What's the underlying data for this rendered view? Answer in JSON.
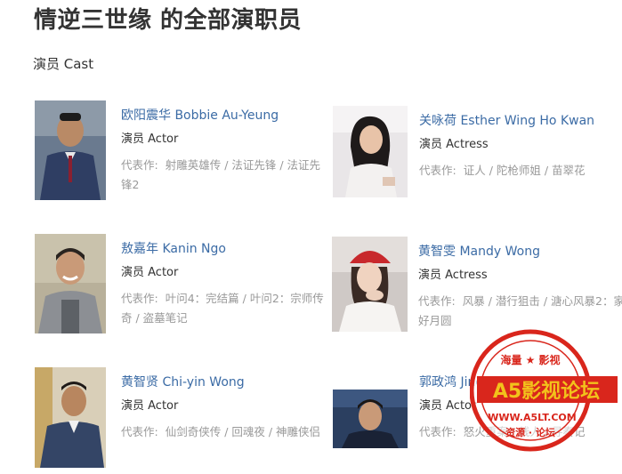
{
  "header": {
    "title": "情逆三世缘 的全部演职员",
    "section": "演员 Cast"
  },
  "cast": [
    {
      "name": "欧阳震华 Bobbie Au-Yeung",
      "role": "演员 Actor",
      "works_label": "代表作:",
      "works": "射雕英雄传 / 法证先锋 / 法证先锋2"
    },
    {
      "name": "关咏荷 Esther Wing Ho Kwan",
      "role": "演员 Actress",
      "works_label": "代表作:",
      "works": "证人 / 陀枪师姐 / 苗翠花"
    },
    {
      "name": "敖嘉年 Kanin Ngo",
      "role": "演员 Actor",
      "works_label": "代表作:",
      "works": "叶问4：完结篇 / 叶问2：宗师传奇 / 盗墓笔记"
    },
    {
      "name": "黄智雯 Mandy Wong",
      "role": "演员 Actress",
      "works_label": "代表作:",
      "works": "风暴 / 潜行狙击 / 溏心风暴2：家好月圆"
    },
    {
      "name": "黄智贤 Chi-yin Wong",
      "role": "演员 Actor",
      "works_label": "代表作:",
      "works": "仙剑奇侠传 / 回魂夜 / 神雕侠侣"
    },
    {
      "name": "郭政鸿 Jing-hung Kwok",
      "role": "演员 Actor",
      "works_label": "代表作:",
      "works": "怒火重案 / 线人 / 寻秦记"
    }
  ],
  "watermark": {
    "top_text": "海量 ★ 影视",
    "brand": "A5影视论坛",
    "url": "WWW.A5LT.COM",
    "bottom_text": "资源 · 论坛"
  },
  "colors": {
    "name_link": "#3b6ba5",
    "muted": "#999999",
    "stamp_red": "#d9261c",
    "stamp_gold": "#f2c21b"
  }
}
